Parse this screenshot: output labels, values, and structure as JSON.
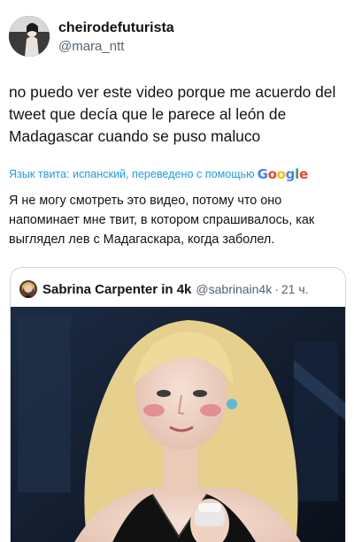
{
  "author": {
    "display_name": "cheirodefuturista",
    "handle": "@mara_ntt",
    "avatar_icon": "profile-photo"
  },
  "tweet": {
    "text": "no puedo ver este video porque me acuerdo del tweet que decía que le parece al león de Madagascar cuando se puso maluco"
  },
  "translation": {
    "label": "Язык твита: испанский, переведено с помощью",
    "provider": "Google",
    "text": "Я не могу смотреть это видео, потому что оно напоминает мне твит, в котором спрашивалось, как выглядел лев с Мадагаскара, когда заболел."
  },
  "quoted_tweet": {
    "display_name": "Sabrina Carpenter in 4k",
    "handle": "@sabrinain4k",
    "separator": "·",
    "time": "21 ч.",
    "media_icon": "video-still-photo"
  },
  "colors": {
    "link_blue": "#1d9bf0",
    "secondary_text": "#536471",
    "border": "#cfd9de"
  }
}
